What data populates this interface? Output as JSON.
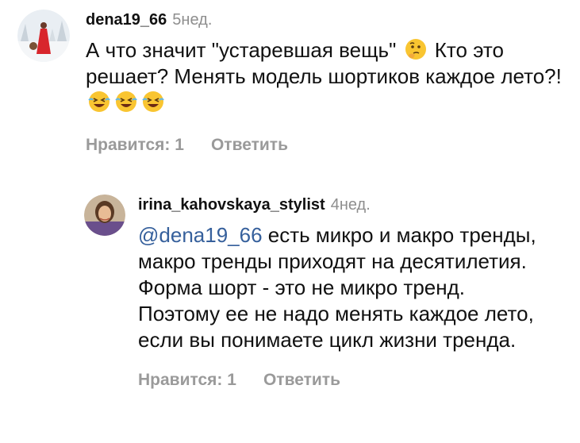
{
  "comments": [
    {
      "username": "dena19_66",
      "time": "5нед.",
      "text_parts": [
        "А что значит \"устаревшая вещь\" ",
        " Кто это решает? Менять модель шортиков каждое лето?! "
      ],
      "emojis": [
        "thinking-face-emoji",
        "rolling-on-floor-laughing-emoji"
      ],
      "likes_label": "Нравится: 1",
      "reply_label": "Ответить"
    },
    {
      "username": "irina_kahovskaya_stylist",
      "time": "4нед.",
      "mention": "@dena19_66",
      "text": " есть микро и макро тренды, макро тренды приходят на десятилетия. Форма шорт - это не микро тренд. Поэтому ее не надо менять каждое лето, если вы понимаете цикл жизни тренда.",
      "likes_label": "Нравится: 1",
      "reply_label": "Ответить"
    }
  ],
  "colors": {
    "text": "#111111",
    "meta": "#8e8e8e",
    "action": "#9a9a9a",
    "mention": "#36609c"
  }
}
